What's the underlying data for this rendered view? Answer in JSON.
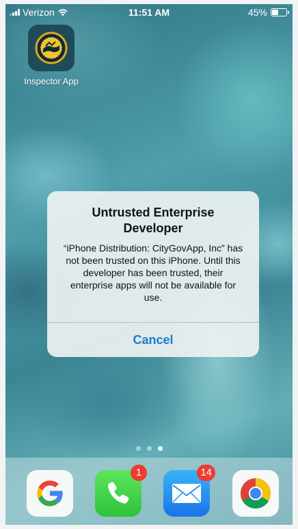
{
  "status_bar": {
    "carrier": "Verizon",
    "time": "11:51 AM",
    "battery": "45%",
    "battery_level": 0.45
  },
  "home": {
    "apps": [
      {
        "label": "Inspector App",
        "icon": "city-seal-icon"
      }
    ]
  },
  "alert": {
    "title": "Untrusted Enterprise Developer",
    "message": "“iPhone Distribution: CityGovApp, Inc” has not been trusted on this iPhone. Until this developer has been trusted, their enterprise apps will not be available for use.",
    "button": "Cancel"
  },
  "page_dots": {
    "count": 3,
    "active_index": 2
  },
  "dock": {
    "apps": [
      {
        "icon": "google-icon"
      },
      {
        "icon": "phone-icon",
        "badge": "1"
      },
      {
        "icon": "mail-icon",
        "badge": "14"
      },
      {
        "icon": "chrome-icon"
      }
    ]
  },
  "colors": {
    "alert_button": "#1d7bd6",
    "badge": "#f03b30"
  }
}
